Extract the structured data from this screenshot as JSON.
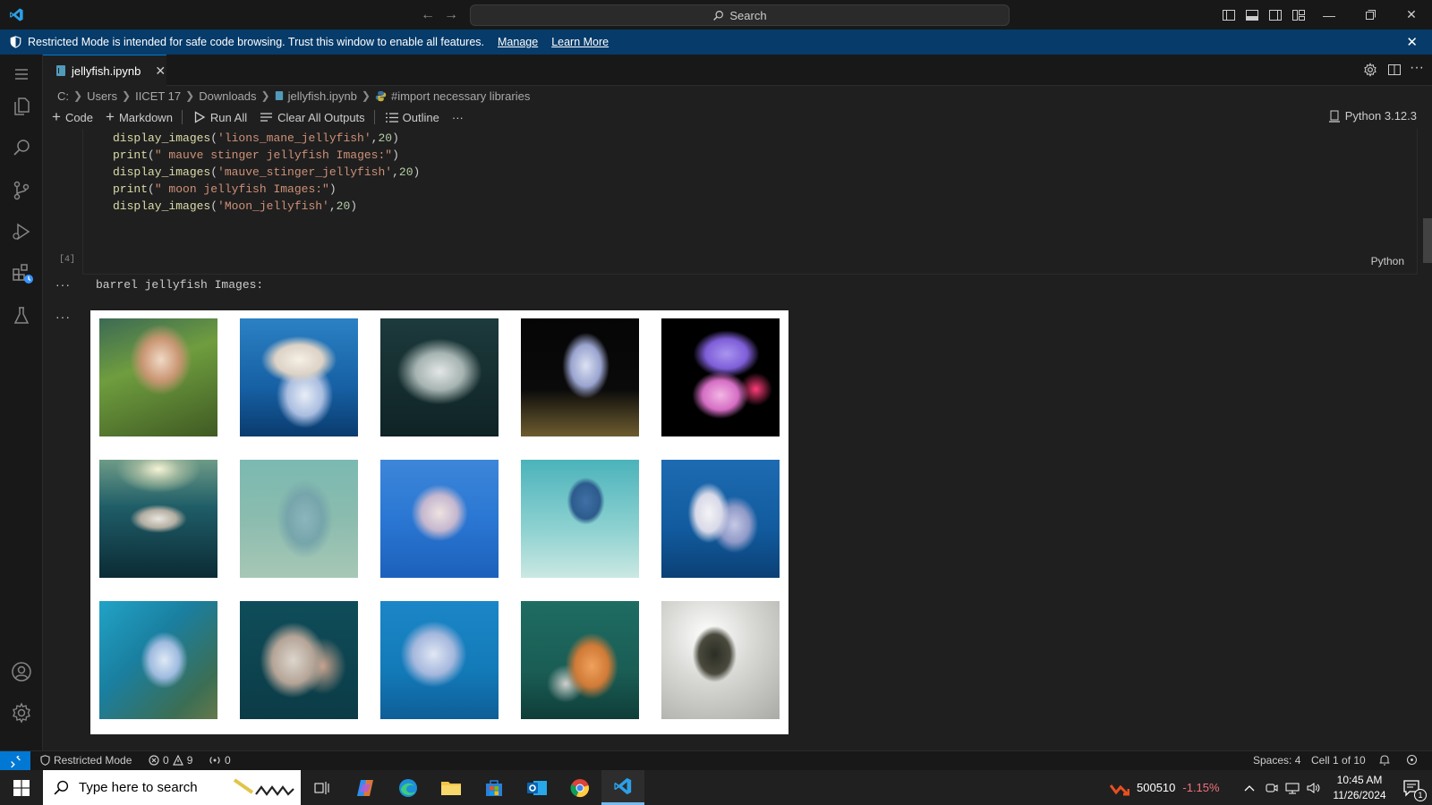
{
  "titlebar": {
    "search_placeholder": "Search"
  },
  "banner": {
    "message": "Restricted Mode is intended for safe code browsing. Trust this window to enable all features.",
    "manage": "Manage",
    "learn_more": "Learn More"
  },
  "tab": {
    "filename": "jellyfish.ipynb"
  },
  "breadcrumb": [
    "C:",
    "Users",
    "IICET 17",
    "Downloads",
    "jellyfish.ipynb",
    "#import necessary libraries"
  ],
  "toolbar": {
    "code": "Code",
    "markdown": "Markdown",
    "run_all": "Run All",
    "clear_all": "Clear All Outputs",
    "outline": "Outline",
    "more": "···",
    "kernel": "Python 3.12.3"
  },
  "cell": {
    "exec_count": "[4]",
    "language": "Python",
    "lines": [
      {
        "fn": "display_images",
        "open": "(",
        "arg": "'lions_mane_jellyfish'",
        "comma": ",",
        "num": "20",
        "close": ")"
      },
      {
        "fn": "print",
        "open": "(",
        "arg": "\" mauve stinger jellyfish Images:\"",
        "comma": "",
        "num": "",
        "close": ")"
      },
      {
        "fn": "display_images",
        "open": "(",
        "arg": "'mauve_stinger_jellyfish'",
        "comma": ",",
        "num": "20",
        "close": ")"
      },
      {
        "fn": "print",
        "open": "(",
        "arg": "\" moon jellyfish Images:\"",
        "comma": "",
        "num": "",
        "close": ")"
      },
      {
        "fn": "display_images",
        "open": "(",
        "arg": "'Moon_jellyfish'",
        "comma": ",",
        "num": "20",
        "close": ")"
      }
    ]
  },
  "output": {
    "text": "barrel jellyfish Images:",
    "dots": "···"
  },
  "statusbar": {
    "restricted": "Restricted Mode",
    "errors": "0",
    "warnings": "9",
    "ports": "0",
    "spaces": "Spaces: 4",
    "cell_pos": "Cell 1 of 10"
  },
  "taskbar": {
    "search_placeholder": "Type here to search",
    "stock_value": "500510",
    "stock_change": "-1.15%",
    "time": "10:45 AM",
    "date": "11/26/2024",
    "notif_count": "1"
  },
  "colors": {
    "accent": "#0078d4",
    "banner": "#063b6a",
    "stock_negative": "#f1707b"
  }
}
